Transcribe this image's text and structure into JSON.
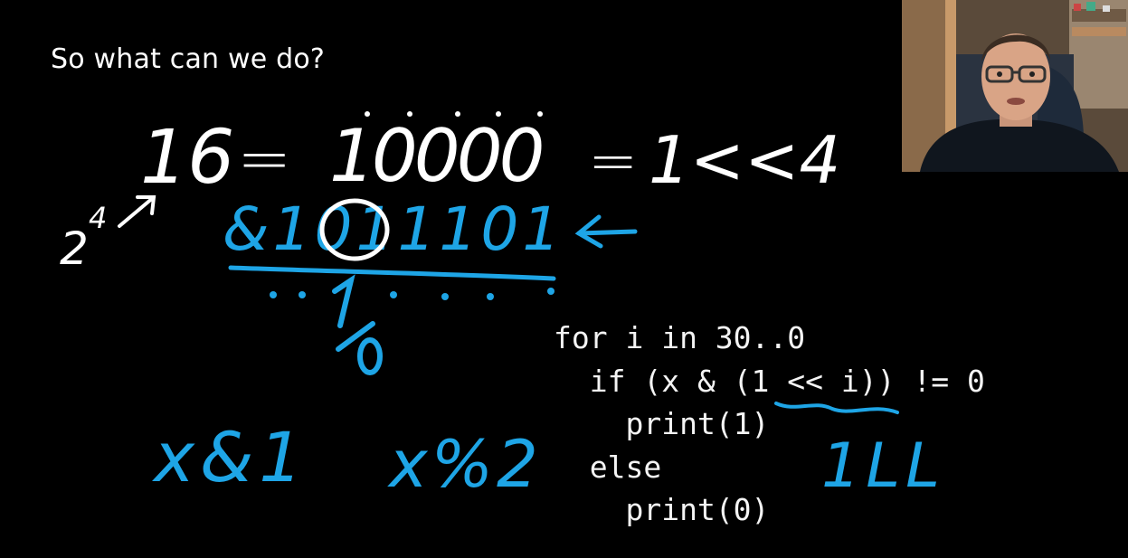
{
  "slide": {
    "title": "So what can we do?"
  },
  "code": {
    "lines": [
      "for i in 30..0",
      "  if (x & (1 << i)) != 0",
      "    print(1)",
      "  else",
      "    print(0)"
    ]
  },
  "handwriting": {
    "white_equation": {
      "left": "16",
      "eq1": "=",
      "middle": "10000",
      "eq2": "=",
      "right": "1<<4"
    },
    "power": {
      "base": "2",
      "exponent": "4"
    },
    "blue_binary": "&1011101",
    "blue_result": "..1....",
    "blue_fraction": "1/0",
    "blue_x_and_1": "x&1",
    "blue_x_mod_2": "x%2",
    "blue_1LL": "1LL"
  },
  "colors": {
    "background": "#000000",
    "white_ink": "#ffffff",
    "blue_ink": "#1ea5e6",
    "code_text": "#f4f4f4"
  },
  "webcam": {
    "description_icon": "presenter-webcam"
  }
}
